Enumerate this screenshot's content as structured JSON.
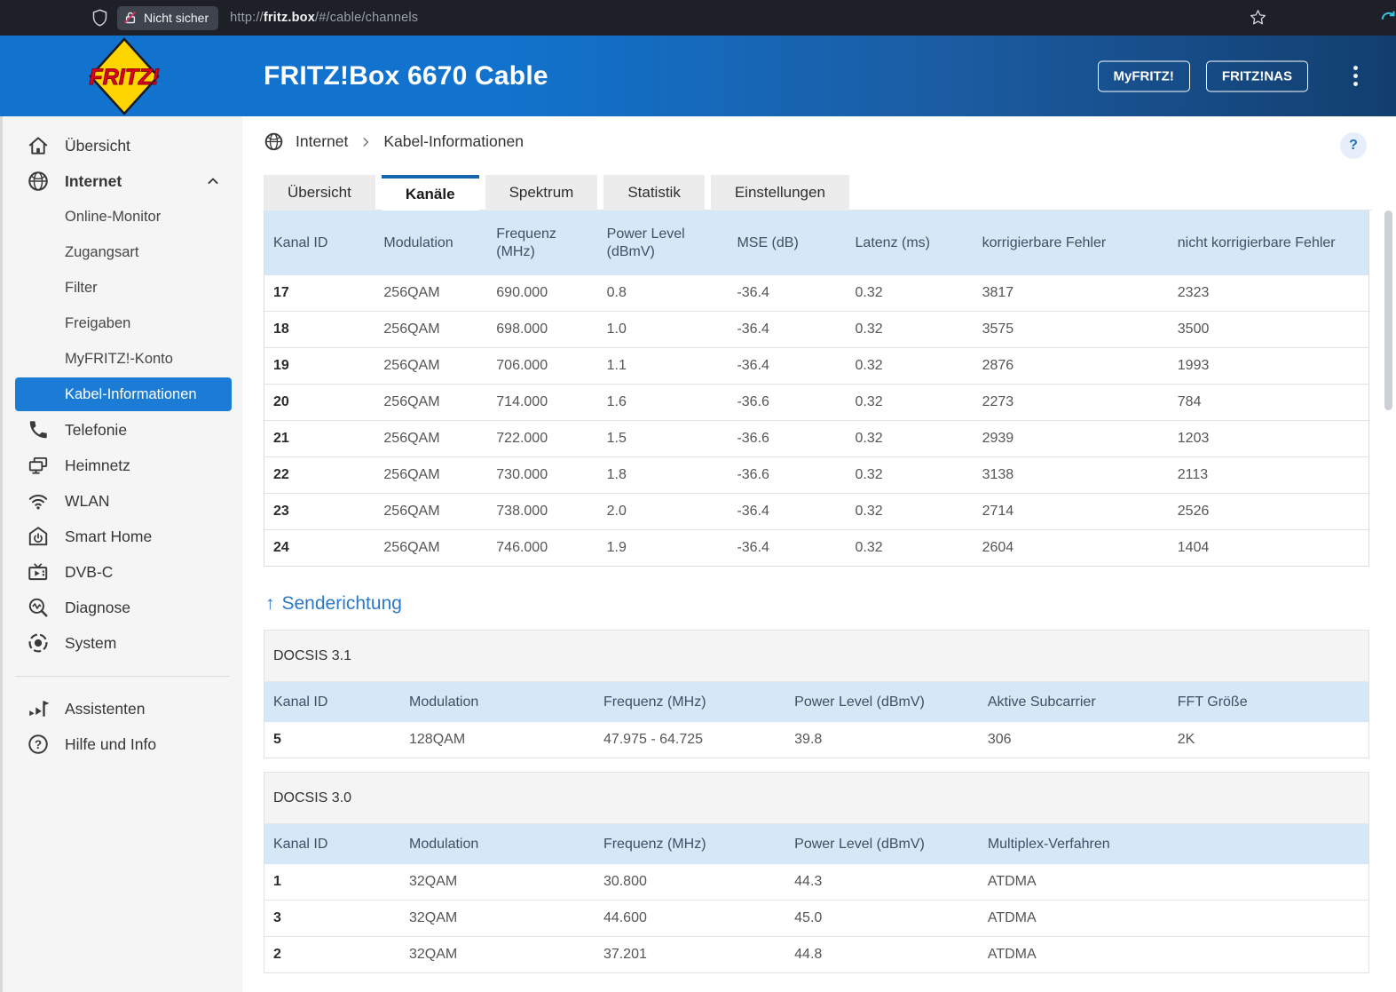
{
  "browser": {
    "security_badge": "Nicht sicher",
    "url_prefix": "http://",
    "url_host": "fritz.box",
    "url_path": "/#/cable/channels"
  },
  "header": {
    "logo_text": "FRITZ!",
    "title": "FRITZ!Box 6670 Cable",
    "myfritz_button": "MyFRITZ!",
    "fritznas_button": "FRITZ!NAS"
  },
  "sidebar": {
    "uebersicht": "Übersicht",
    "internet": "Internet",
    "internet_sub": [
      "Online-Monitor",
      "Zugangsart",
      "Filter",
      "Freigaben",
      "MyFRITZ!-Konto",
      "Kabel-Informationen"
    ],
    "telefonie": "Telefonie",
    "heimnetz": "Heimnetz",
    "wlan": "WLAN",
    "smarthome": "Smart Home",
    "dvbc": "DVB-C",
    "diagnose": "Diagnose",
    "system": "System",
    "assistenten": "Assistenten",
    "hilfe": "Hilfe und Info"
  },
  "breadcrumb": {
    "level1": "Internet",
    "level2": "Kabel-Informationen"
  },
  "help_button": "?",
  "tabs": [
    "Übersicht",
    "Kanäle",
    "Spektrum",
    "Statistik",
    "Einstellungen"
  ],
  "downstream_table": {
    "headers": [
      "Kanal ID",
      "Modulation",
      "Frequenz (MHz)",
      "Power Level (dBmV)",
      "MSE (dB)",
      "Latenz (ms)",
      "korrigierbare Fehler",
      "nicht korrigierbare Fehler"
    ],
    "rows": [
      [
        "17",
        "256QAM",
        "690.000",
        "0.8",
        "-36.4",
        "0.32",
        "3817",
        "2323"
      ],
      [
        "18",
        "256QAM",
        "698.000",
        "1.0",
        "-36.4",
        "0.32",
        "3575",
        "3500"
      ],
      [
        "19",
        "256QAM",
        "706.000",
        "1.1",
        "-36.4",
        "0.32",
        "2876",
        "1993"
      ],
      [
        "20",
        "256QAM",
        "714.000",
        "1.6",
        "-36.6",
        "0.32",
        "2273",
        "784"
      ],
      [
        "21",
        "256QAM",
        "722.000",
        "1.5",
        "-36.6",
        "0.32",
        "2939",
        "1203"
      ],
      [
        "22",
        "256QAM",
        "730.000",
        "1.8",
        "-36.6",
        "0.32",
        "3138",
        "2113"
      ],
      [
        "23",
        "256QAM",
        "738.000",
        "2.0",
        "-36.4",
        "0.32",
        "2714",
        "2526"
      ],
      [
        "24",
        "256QAM",
        "746.000",
        "1.9",
        "-36.4",
        "0.32",
        "2604",
        "1404"
      ]
    ]
  },
  "upstream": {
    "arrow": "↑",
    "heading": "Senderichtung",
    "docsis31": {
      "group_title": "DOCSIS 3.1",
      "headers": [
        "Kanal ID",
        "Modulation",
        "Frequenz (MHz)",
        "Power Level (dBmV)",
        "Aktive Subcarrier",
        "FFT Größe"
      ],
      "rows": [
        [
          "5",
          "128QAM",
          "47.975 - 64.725",
          "39.8",
          "306",
          "2K"
        ]
      ]
    },
    "docsis30": {
      "group_title": "DOCSIS 3.0",
      "headers": [
        "Kanal ID",
        "Modulation",
        "Frequenz (MHz)",
        "Power Level (dBmV)",
        "Multiplex-Verfahren"
      ],
      "rows": [
        [
          "1",
          "32QAM",
          "30.800",
          "44.3",
          "ATDMA"
        ],
        [
          "3",
          "32QAM",
          "44.600",
          "45.0",
          "ATDMA"
        ],
        [
          "2",
          "32QAM",
          "37.201",
          "44.8",
          "ATDMA"
        ]
      ]
    }
  },
  "colors": {
    "accent_blue": "#1c7cd5",
    "header_gradient_start": "#1173cd",
    "header_gradient_end": "#123e6e",
    "table_header_bg": "#d6e7f7",
    "selected_item_bg": "#1c7cd5",
    "link_blue": "#2b79c5",
    "logo_yellow": "#ffd500",
    "logo_red": "#e2001a"
  }
}
